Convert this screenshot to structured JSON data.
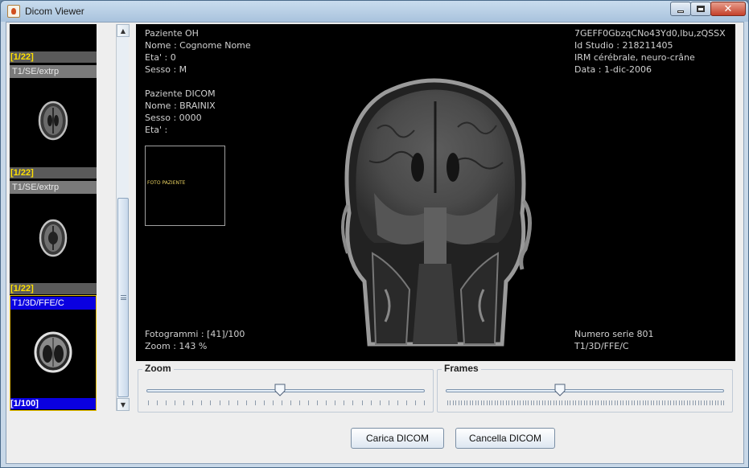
{
  "window": {
    "title": "Dicom Viewer"
  },
  "thumbnails": {
    "items": [
      {
        "counter": "[1/22]",
        "series": "T1/SE/extrp"
      },
      {
        "counter": "[1/22]",
        "series": "T1/SE/extrp"
      },
      {
        "counter": "[1/22]",
        "series": "T1/3D/FFE/C"
      },
      {
        "counter": "[1/100]"
      }
    ]
  },
  "overlay": {
    "patient_oh": {
      "heading": "Paziente OH",
      "name": "Nome : Cognome Nome",
      "age": "Eta' : 0",
      "sex": "Sesso : M"
    },
    "patient_dicom": {
      "heading": "Paziente DICOM",
      "name": "Nome : BRAINIX",
      "sex": "Sesso : 0000",
      "age": "Eta' :"
    },
    "photo_label": "FOTO PAZIENTE",
    "study": {
      "uid": "7GEFF0GbzqCNo43Yd0,lbu,zQSSX",
      "id": "Id Studio : 218211405",
      "description": "IRM cérébrale, neuro-crâne",
      "date": "Data : 1-dic-2006"
    },
    "frames": "Fotogrammi : [41]/100",
    "zoom": "Zoom : 143 %",
    "series_number": "Numero serie 801",
    "series_name": "T1/3D/FFE/C"
  },
  "controls": {
    "zoom": {
      "label": "Zoom",
      "value_fraction": 0.48
    },
    "frames": {
      "label": "Frames",
      "value_fraction": 0.41
    }
  },
  "buttons": {
    "load": "Carica DICOM",
    "delete": "Cancella DICOM"
  }
}
